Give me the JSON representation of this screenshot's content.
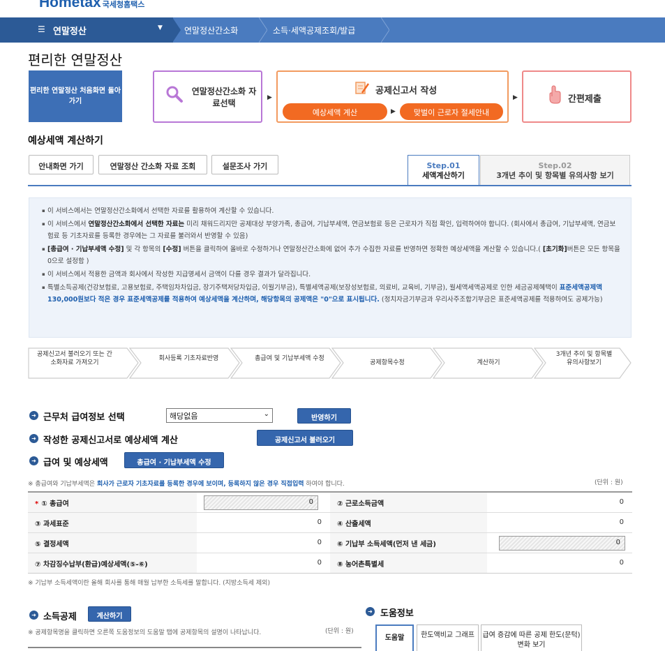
{
  "logo": {
    "brand": "Hometax",
    "sub": "국세청홈택스"
  },
  "nav": {
    "menu_label": "연말정산",
    "crumb1": "연말정산간소화",
    "crumb2": "소득·세액공제조회/발급"
  },
  "page_title": "편리한 연말정산",
  "back_button": "편리한 연말정산 처음화면 돌아가기",
  "step_box1": {
    "label": "연말정산간소화 자료선택",
    "icon": "magnifier-icon"
  },
  "step_box2": {
    "label": "공제신고서 작성",
    "pill1": "예상세액 계산",
    "pill2": "맞벌이 근로자 절세안내",
    "icon": "form-pen-icon"
  },
  "step_box3": {
    "label": "간편제출",
    "icon": "hand-pointer-icon"
  },
  "section_title": "예상세액 계산하기",
  "buttons": {
    "guide": "안내화면 가기",
    "lookup": "연말정산 간소화 자료 조회",
    "survey": "설문조사 가기"
  },
  "tabs": [
    {
      "step": "Step.01",
      "label": "세액계산하기"
    },
    {
      "step": "Step.02",
      "label": "3개년 추이 및 항목별 유의사항 보기"
    }
  ],
  "notice": {
    "n1": "이 서비스에서는 연말정산간소화에서 선택한 자료를 활용하여 계산할 수 있습니다.",
    "n2a": "이 서비스에서 ",
    "n2b": "연말정산간소화에서 선택한 자료는",
    "n2c": " 미리 채워드리지만 공제대상 부양가족, 총급여, 기납부세액, 연금보험료 등은 근로자가 직접 확인, 입력하여야 합니다. (회사에서 총급여, 기납부세액, 연금보험료 등 기초자료를 등록한 경우에는 그 자료를 불러와서 반영할 수 있음)",
    "n3a": "[총급여 · 기납부세액 수정]",
    "n3b": " 및 각 항목의 ",
    "n3c": "[수정]",
    "n3d": " 버튼을 클릭하여 올바로 수정하거나 연말정산간소화에 없어 추가 수집한 자료를 반영하면 정확한 예상세액을 계산할 수 있습니다.( ",
    "n3e": "[초기화]",
    "n3f": "버튼은 모든 항목을 0으로 설정함 )",
    "n4": "이 서비스에서 적용한 금액과 회사에서 작성한 지급명세서 금액이 다를 경우 결과가 달라집니다.",
    "n5a": "특별소득공제(건강보험료, 고용보험료, 주택임차차입금, 장기주택저당차입금, 이월기부금), 특별세액공제(보장성보험료, 의료비, 교육비, 기부금), 월세액세액공제로 인한 세금공제혜택이 ",
    "n5b": "표준세액공제액 130,000원보다 적은 경우 표준세액공제를 적용하여 예상세액을 계산하며, 해당항목의 공제액은 \"0\"으로 표시됩니다.",
    "n5c": " (정치자금기부금과 우리사주조합기부금은 표준세액공제를 적용하여도 공제가능)"
  },
  "process": [
    "공제신고서 불러오기 또는 간소화자료 가져오기",
    "회사등록 기초자료반영",
    "총급여 및 기납부세액 수정",
    "공제항목수정",
    "계산하기",
    "3개년 추이 및 항목별 유의사항보기"
  ],
  "work_select": {
    "title": "근무처 급여정보 선택",
    "value": "해당없음",
    "button": "반영하기"
  },
  "draft_calc": {
    "title": "작성한 공제신고서로 예상세액 계산",
    "button": "공제신고서 불러오기"
  },
  "salary": {
    "title": "급여 및 예상세액",
    "button": "총급여 · 기납부세액 수정"
  },
  "salary_note": {
    "a": "※ 총급여와 기납부세액은 ",
    "b": "회사가 근로자 기초자료를 등록한 경우에 보이며, 등록하지 않은 경우 직접입력",
    "c": " 하여야 합니다."
  },
  "unit": "(단위 : 원)",
  "table": [
    {
      "l1": "① 총급여",
      "v1": "0",
      "l2": "② 근로소득금액",
      "v2": "0"
    },
    {
      "l1": "③ 과세표준",
      "v1": "0",
      "l2": "④ 산출세액",
      "v2": "0"
    },
    {
      "l1": "⑤ 결정세액",
      "v1": "0",
      "l2": "⑥ 기납부 소득세액(먼저 낸 세금)",
      "v2": "0"
    },
    {
      "l1": "⑦ 차감징수납부(환급)예상세액(⑤-⑥)",
      "v1": "0",
      "l2": "⑧ 농어촌특별세",
      "v2": "0"
    }
  ],
  "required_mark": "*",
  "table_note": "※ 기납부 소득세액이란 올해 회사를 통해 매월 납부한 소득세를 말합니다. (지방소득세 제외)",
  "income": {
    "title": "소득공제",
    "button": "계산하기",
    "note": "※ 공제항목명을 클릭하면 오른쪽 도움정보의 도움말 탭에 공제항목의 설명이 나타납니다.",
    "unit": "(단위 : 원)"
  },
  "help": {
    "title": "도움정보",
    "tabs": [
      "도움말",
      "한도액비교 그래프",
      "급여 증감에 따른 공제 한도(문턱) 변화 보기"
    ]
  }
}
